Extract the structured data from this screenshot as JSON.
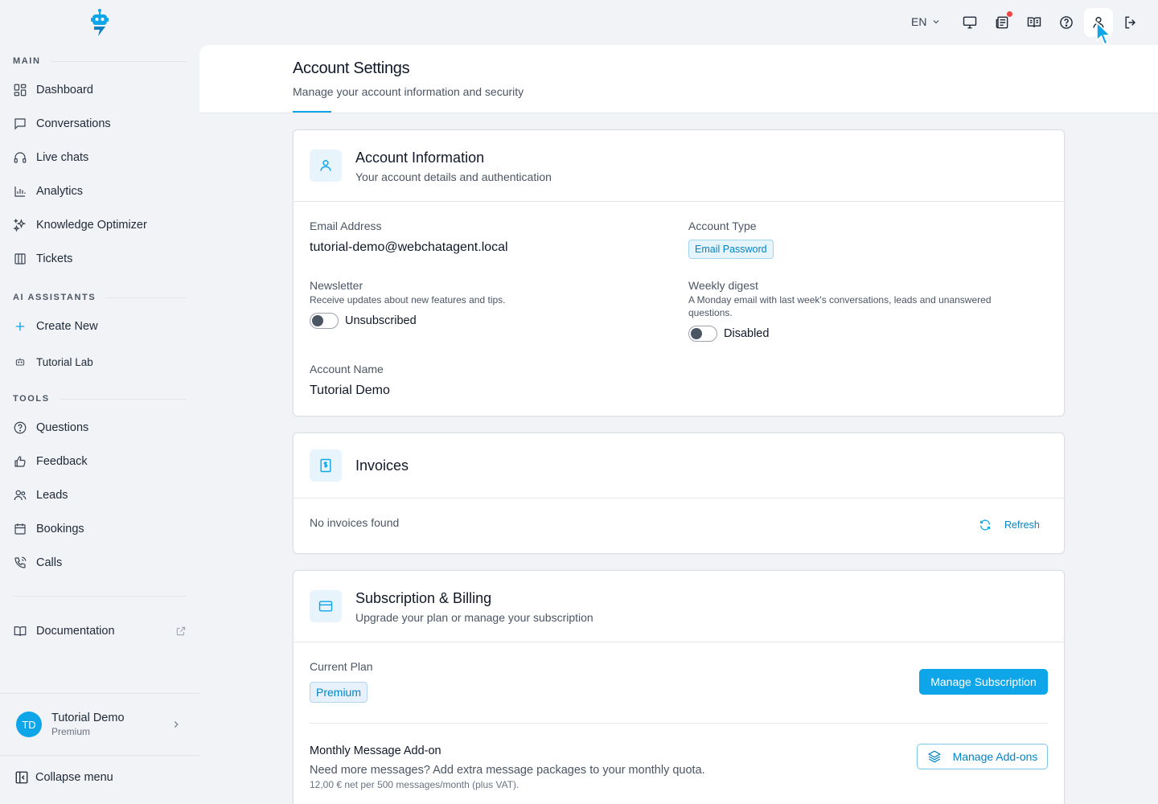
{
  "colors": {
    "accent": "#0ea5e9",
    "accent_dark": "#0284c7",
    "notification": "#ef4444"
  },
  "sidebar": {
    "sections": {
      "main": "MAIN",
      "ai_assistants": "AI ASSISTANTS",
      "tools": "TOOLS"
    },
    "main_items": [
      {
        "label": "Dashboard",
        "icon": "dashboard-icon"
      },
      {
        "label": "Conversations",
        "icon": "chat-bubble-icon"
      },
      {
        "label": "Live chats",
        "icon": "headset-icon"
      },
      {
        "label": "Analytics",
        "icon": "bar-chart-icon"
      },
      {
        "label": "Knowledge Optimizer",
        "icon": "sparkles-icon"
      },
      {
        "label": "Tickets",
        "icon": "columns-icon"
      }
    ],
    "ai_items": [
      {
        "label": "Create New",
        "icon": "plus-icon"
      },
      {
        "label": "Tutorial Lab",
        "icon": "robot-icon"
      }
    ],
    "tool_items": [
      {
        "label": "Questions",
        "icon": "question-icon"
      },
      {
        "label": "Feedback",
        "icon": "thumbs-up-icon"
      },
      {
        "label": "Leads",
        "icon": "users-icon"
      },
      {
        "label": "Bookings",
        "icon": "calendar-icon"
      },
      {
        "label": "Calls",
        "icon": "phone-icon"
      }
    ],
    "documentation": "Documentation",
    "user": {
      "initials": "TD",
      "name": "Tutorial Demo",
      "plan": "Premium"
    },
    "collapse": "Collapse menu"
  },
  "topbar": {
    "language": "EN"
  },
  "page": {
    "title": "Account Settings",
    "subtitle": "Manage your account information and security"
  },
  "account_info": {
    "title": "Account Information",
    "subtitle": "Your account details and authentication",
    "email_label": "Email Address",
    "email_value": "tutorial-demo@webchatagent.local",
    "type_label": "Account Type",
    "type_value": "Email Password",
    "newsletter_label": "Newsletter",
    "newsletter_desc": "Receive updates about new features and tips.",
    "newsletter_state": "Unsubscribed",
    "digest_label": "Weekly digest",
    "digest_desc": "A Monday email with last week's conversations, leads and unanswered questions.",
    "digest_state": "Disabled",
    "name_label": "Account Name",
    "name_value": "Tutorial Demo"
  },
  "invoices": {
    "title": "Invoices",
    "empty": "No invoices found",
    "refresh": "Refresh"
  },
  "subscription": {
    "title": "Subscription & Billing",
    "subtitle": "Upgrade your plan or manage your subscription",
    "current_plan_label": "Current Plan",
    "current_plan_value": "Premium",
    "manage_subscription": "Manage Subscription",
    "addon_title": "Monthly Message Add-on",
    "addon_desc": "Need more messages? Add extra message packages to your monthly quota.",
    "addon_price": "12,00 € net per 500 messages/month (plus VAT).",
    "manage_addons": "Manage Add-ons"
  }
}
